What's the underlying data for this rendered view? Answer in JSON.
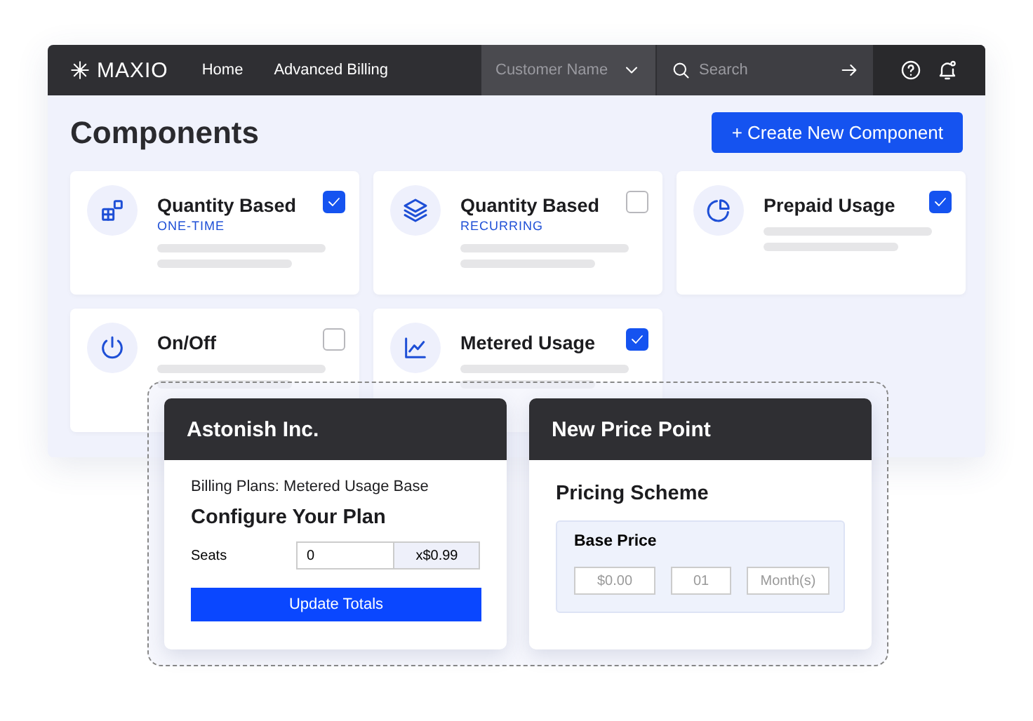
{
  "header": {
    "logo": "MAXIO",
    "nav": [
      {
        "label": "Home"
      },
      {
        "label": "Advanced Billing"
      }
    ],
    "customer_select": {
      "placeholder": "Customer Name"
    },
    "search": {
      "placeholder": "Search"
    }
  },
  "page": {
    "title": "Components",
    "create_button": "+ Create New Component"
  },
  "components": [
    {
      "title": "Quantity Based",
      "subtitle": "ONE-TIME",
      "checked": true
    },
    {
      "title": "Quantity Based",
      "subtitle": "RECURRING",
      "checked": false
    },
    {
      "title": "Prepaid Usage",
      "checked": true
    },
    {
      "title": "On/Off",
      "checked": false
    },
    {
      "title": "Metered Usage",
      "checked": true
    }
  ],
  "plan_card": {
    "title": "Astonish Inc.",
    "billing_plans": "Billing Plans: Metered Usage Base",
    "heading": "Configure Your Plan",
    "seats_label": "Seats",
    "seats_value": "0",
    "unit_price": "x$0.99",
    "button": "Update Totals"
  },
  "price_card": {
    "title": "New Price Point",
    "heading": "Pricing Scheme",
    "base_price": {
      "label": "Base Price",
      "amount": {
        "placeholder": "$0.00"
      },
      "count": {
        "placeholder": "01"
      },
      "unit": {
        "placeholder": "Month(s)"
      }
    }
  }
}
